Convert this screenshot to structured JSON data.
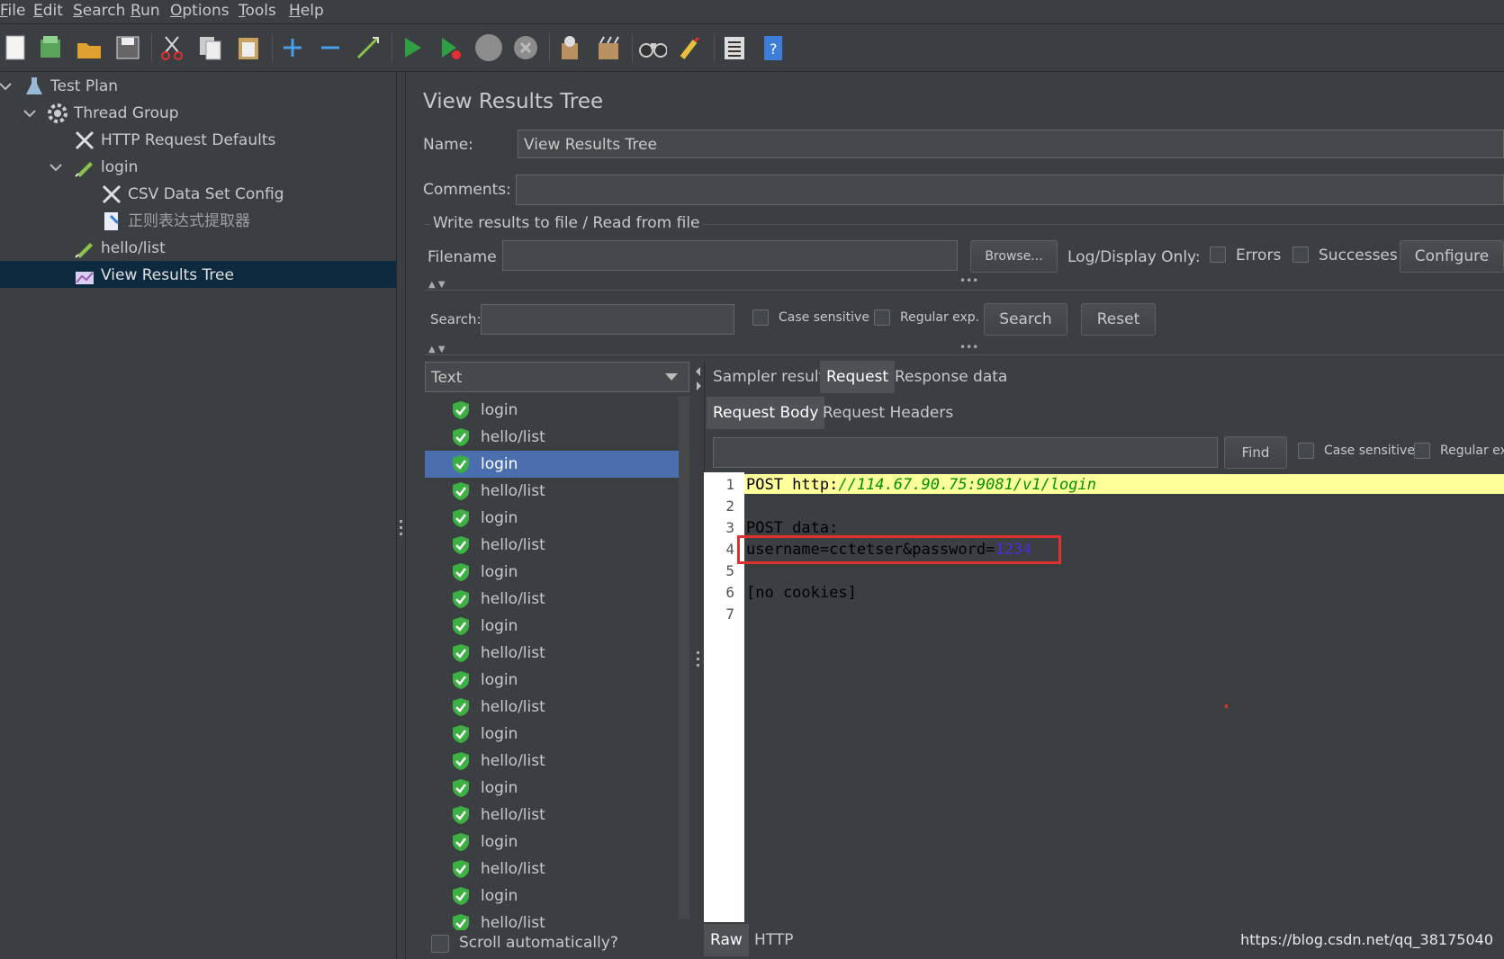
{
  "menu": [
    "File",
    "Edit",
    "Search",
    "Run",
    "Options",
    "Tools",
    "Help"
  ],
  "toolbar_icons": [
    "new-icon",
    "templates-icon",
    "open-icon",
    "save-icon",
    "cut-icon",
    "copy-icon",
    "paste-icon",
    "expand-icon",
    "collapse-icon",
    "toggle-icon",
    "start-icon",
    "start-no-pauses-icon",
    "stop-icon",
    "shutdown-icon",
    "clear-icon",
    "clear-all-icon",
    "search-icon",
    "reset-search-icon",
    "function-helper-icon",
    "help-icon"
  ],
  "tree": [
    {
      "label": "Test Plan",
      "icon": "flask-icon"
    },
    {
      "label": "Thread Group",
      "icon": "gear-icon"
    },
    {
      "label": "HTTP Request Defaults",
      "icon": "tools-icon"
    },
    {
      "label": "login",
      "icon": "pencil-icon"
    },
    {
      "label": "CSV Data Set Config",
      "icon": "tools-icon"
    },
    {
      "label": "正则表达式提取器",
      "icon": "document-icon"
    },
    {
      "label": "hello/list",
      "icon": "pencil-icon"
    },
    {
      "label": "View Results Tree",
      "icon": "chart-icon"
    }
  ],
  "panel": {
    "title": "View Results Tree",
    "name_label": "Name:",
    "name_value": "View Results Tree",
    "comments_label": "Comments:",
    "comments_value": "",
    "file_section": "Write results to file / Read from file",
    "filename_label": "Filename",
    "filename_value": "",
    "browse": "Browse...",
    "log_display": "Log/Display Only:",
    "errors": "Errors",
    "successes": "Successes",
    "configure": "Configure",
    "search_label": "Search:",
    "search_value": "",
    "case_sensitive": "Case sensitive",
    "regular_exp": "Regular exp.",
    "search_button": "Search",
    "reset_button": "Reset"
  },
  "renderer": "Text",
  "results": [
    "login",
    "hello/list",
    "login",
    "hello/list",
    "login",
    "hello/list",
    "login",
    "hello/list",
    "login",
    "hello/list",
    "login",
    "hello/list",
    "login",
    "hello/list",
    "login",
    "hello/list",
    "login",
    "hello/list",
    "login",
    "hello/list"
  ],
  "selected_result_index": 2,
  "scroll_auto": "Scroll automatically?",
  "tabs": [
    "Sampler result",
    "Request",
    "Response data"
  ],
  "active_tab": "Request",
  "subtabs": [
    "Request Body",
    "Request Headers"
  ],
  "active_subtab": "Request Body",
  "find": {
    "value": "",
    "button": "Find",
    "case_sensitive": "Case sensitive",
    "regular_exp": "Regular exp"
  },
  "code": {
    "line_numbers": [
      "1",
      "2",
      "3",
      "4",
      "5",
      "6",
      "7"
    ],
    "line1_prefix": "POST http:",
    "line1_url": "//114.67.90.75:9081/v1/login",
    "line3": "POST data:",
    "line4_a": "username=cctetser&password=",
    "line4_b": "1234",
    "line6": "[no cookies]"
  },
  "bottom_tabs": [
    "Raw",
    "HTTP"
  ],
  "watermark": "https://blog.csdn.net/qq_38175040",
  "colors": {
    "background": "#3c3f41",
    "selection": "#4b6eaf",
    "tree_selection": "#0d293e",
    "highlight_line": "#ffff99",
    "annotation": "#ff0000",
    "success": "#3cb043"
  }
}
